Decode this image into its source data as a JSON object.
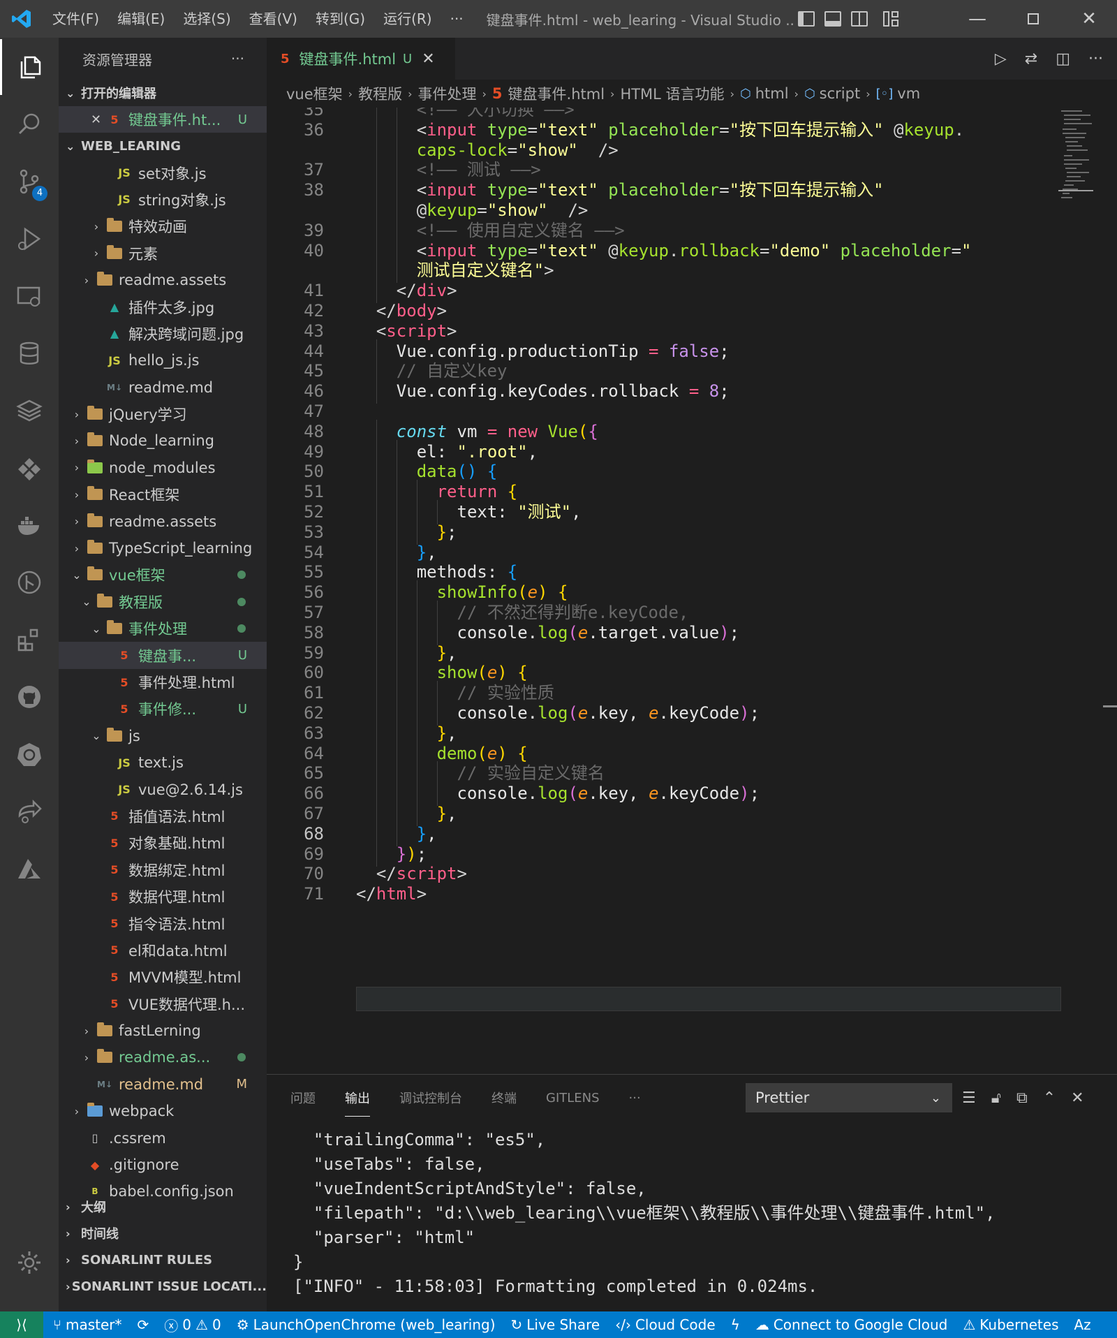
{
  "titlebar": {
    "menus": [
      "文件(F)",
      "编辑(E)",
      "选择(S)",
      "查看(V)",
      "转到(G)",
      "运行(R)",
      "···"
    ],
    "window_title": "键盘事件.html - web_learing - Visual Studio ..."
  },
  "activity": {
    "scm_badge": "4"
  },
  "sidebar": {
    "title": "资源管理器",
    "more": "···",
    "open_editors_label": "打开的编辑器",
    "open_editor": {
      "name": "键盘事件.ht...",
      "status": "U"
    },
    "workspace_label": "WEB_LEARING",
    "tree": [
      {
        "name": "set对象.js",
        "icon": "js",
        "depth": 4
      },
      {
        "name": "string对象.js",
        "icon": "js",
        "depth": 4
      },
      {
        "name": "特效动画",
        "icon": "folder",
        "depth": 3,
        "chevron": "›"
      },
      {
        "name": "元素",
        "icon": "folder",
        "depth": 3,
        "chevron": "›"
      },
      {
        "name": "readme.assets",
        "icon": "folder",
        "depth": 2,
        "chevron": "›"
      },
      {
        "name": "插件太多.jpg",
        "icon": "img",
        "depth": 3
      },
      {
        "name": "解决跨域问题.jpg",
        "icon": "img",
        "depth": 3
      },
      {
        "name": "hello_js.js",
        "icon": "js",
        "depth": 3
      },
      {
        "name": "readme.md",
        "icon": "md",
        "depth": 3
      },
      {
        "name": "jQuery学习",
        "icon": "folder",
        "depth": 1,
        "chevron": "›"
      },
      {
        "name": "Node_learning",
        "icon": "folder",
        "depth": 1,
        "chevron": "›"
      },
      {
        "name": "node_modules",
        "icon": "folder-node",
        "depth": 1,
        "chevron": "›"
      },
      {
        "name": "React框架",
        "icon": "folder",
        "depth": 1,
        "chevron": "›"
      },
      {
        "name": "readme.assets",
        "icon": "folder",
        "depth": 1,
        "chevron": "›"
      },
      {
        "name": "TypeScript_learning",
        "icon": "folder",
        "depth": 1,
        "chevron": "›"
      },
      {
        "name": "vue框架",
        "icon": "folder",
        "depth": 1,
        "chevron": "⌄",
        "color": "green",
        "dot": true
      },
      {
        "name": "教程版",
        "icon": "folder",
        "depth": 2,
        "chevron": "⌄",
        "color": "green",
        "dot": true
      },
      {
        "name": "事件处理",
        "icon": "folder",
        "depth": 3,
        "chevron": "⌄",
        "color": "green",
        "dot": true
      },
      {
        "name": "键盘事...",
        "icon": "html",
        "depth": 4,
        "color": "green",
        "status": "U",
        "selected": true
      },
      {
        "name": "事件处理.html",
        "icon": "html",
        "depth": 4
      },
      {
        "name": "事件修...",
        "icon": "html",
        "depth": 4,
        "color": "green",
        "status": "U"
      },
      {
        "name": "js",
        "icon": "folder",
        "depth": 3,
        "chevron": "⌄"
      },
      {
        "name": "text.js",
        "icon": "js",
        "depth": 4
      },
      {
        "name": "vue@2.6.14.js",
        "icon": "js",
        "depth": 4
      },
      {
        "name": "插值语法.html",
        "icon": "html",
        "depth": 3
      },
      {
        "name": "对象基础.html",
        "icon": "html",
        "depth": 3
      },
      {
        "name": "数据绑定.html",
        "icon": "html",
        "depth": 3
      },
      {
        "name": "数据代理.html",
        "icon": "html",
        "depth": 3
      },
      {
        "name": "指令语法.html",
        "icon": "html",
        "depth": 3
      },
      {
        "name": "el和data.html",
        "icon": "html",
        "depth": 3
      },
      {
        "name": "MVVM模型.html",
        "icon": "html",
        "depth": 3
      },
      {
        "name": "VUE数据代理.h...",
        "icon": "html",
        "depth": 3
      },
      {
        "name": "fastLerning",
        "icon": "folder",
        "depth": 2,
        "chevron": "›"
      },
      {
        "name": "readme.as...",
        "icon": "folder",
        "depth": 2,
        "chevron": "›",
        "color": "green",
        "dot": true
      },
      {
        "name": "readme.md",
        "icon": "md",
        "depth": 2,
        "color": "yellowish",
        "status": "M"
      },
      {
        "name": "webpack",
        "icon": "folder-wp",
        "depth": 1,
        "chevron": "›"
      },
      {
        "name": ".cssrem",
        "icon": "file",
        "depth": 1
      },
      {
        "name": ".gitignore",
        "icon": "git",
        "depth": 1
      },
      {
        "name": "babel.config.json",
        "icon": "babel",
        "depth": 1
      }
    ],
    "bottom_sections": [
      "大纲",
      "时间线",
      "SONARLINT RULES",
      "SONARLINT ISSUE LOCATI..."
    ]
  },
  "tab": {
    "name": "键盘事件.html",
    "status": "U"
  },
  "breadcrumb": [
    "vue框架",
    "教程版",
    "事件处理",
    "键盘事件.html",
    "HTML 语言功能",
    "html",
    "script",
    "vm"
  ],
  "code_lines": [
    {
      "n": "35",
      "i": 3,
      "t": [
        [
          "cm",
          "<!—— 大小切换 ——>"
        ]
      ]
    },
    {
      "n": "36",
      "i": 3,
      "t": [
        [
          "br",
          "<"
        ],
        [
          "tag",
          "input"
        ],
        [
          "id",
          " "
        ],
        [
          "attr",
          "type"
        ],
        [
          "br",
          "="
        ],
        [
          "str",
          "\"text\""
        ],
        [
          "id",
          " "
        ],
        [
          "attr",
          "placeholder"
        ],
        [
          "br",
          "="
        ],
        [
          "str",
          "\"按下回车提示输入\""
        ],
        [
          "id",
          " "
        ],
        [
          "br",
          "@"
        ],
        [
          "dir",
          "keyup"
        ],
        [
          "br",
          "."
        ]
      ]
    },
    {
      "n": "",
      "i": 3,
      "t": [
        [
          "dir",
          "caps-lock"
        ],
        [
          "br",
          "="
        ],
        [
          "str",
          "\"show\""
        ],
        [
          "id",
          "  "
        ],
        [
          "br",
          "/>"
        ]
      ]
    },
    {
      "n": "37",
      "i": 3,
      "t": [
        [
          "cm",
          "<!—— 测试 ——>"
        ]
      ]
    },
    {
      "n": "38",
      "i": 3,
      "t": [
        [
          "br",
          "<"
        ],
        [
          "tag",
          "input"
        ],
        [
          "id",
          " "
        ],
        [
          "attr",
          "type"
        ],
        [
          "br",
          "="
        ],
        [
          "str",
          "\"text\""
        ],
        [
          "id",
          " "
        ],
        [
          "attr",
          "placeholder"
        ],
        [
          "br",
          "="
        ],
        [
          "str",
          "\"按下回车提示输入\""
        ]
      ]
    },
    {
      "n": "",
      "i": 3,
      "t": [
        [
          "br",
          "@"
        ],
        [
          "dir",
          "keyup"
        ],
        [
          "br",
          "="
        ],
        [
          "str",
          "\"show\""
        ],
        [
          "id",
          "  "
        ],
        [
          "br",
          "/>"
        ]
      ]
    },
    {
      "n": "39",
      "i": 3,
      "t": [
        [
          "cm",
          "<!—— 使用自定义键名 ——>"
        ]
      ]
    },
    {
      "n": "40",
      "i": 3,
      "t": [
        [
          "br",
          "<"
        ],
        [
          "tag",
          "input"
        ],
        [
          "id",
          " "
        ],
        [
          "attr",
          "type"
        ],
        [
          "br",
          "="
        ],
        [
          "str",
          "\"text\""
        ],
        [
          "id",
          " "
        ],
        [
          "br",
          "@"
        ],
        [
          "dir",
          "keyup"
        ],
        [
          "br",
          "."
        ],
        [
          "dir",
          "rollback"
        ],
        [
          "br",
          "="
        ],
        [
          "str",
          "\"demo\""
        ],
        [
          "id",
          " "
        ],
        [
          "attr",
          "placeholder"
        ],
        [
          "br",
          "="
        ],
        [
          "str",
          "\""
        ]
      ]
    },
    {
      "n": "",
      "i": 3,
      "t": [
        [
          "str",
          "测试自定义键名\""
        ],
        [
          "br",
          ">"
        ]
      ]
    },
    {
      "n": "41",
      "i": 2,
      "t": [
        [
          "br",
          "</"
        ],
        [
          "tag",
          "div"
        ],
        [
          "br",
          ">"
        ]
      ]
    },
    {
      "n": "42",
      "i": 1,
      "t": [
        [
          "br",
          "</"
        ],
        [
          "tag",
          "body"
        ],
        [
          "br",
          ">"
        ]
      ]
    },
    {
      "n": "43",
      "i": 1,
      "t": [
        [
          "br",
          "<"
        ],
        [
          "tag",
          "script"
        ],
        [
          "br",
          ">"
        ]
      ]
    },
    {
      "n": "44",
      "i": 2,
      "t": [
        [
          "id",
          "Vue.config.productionTip "
        ],
        [
          "op",
          "="
        ],
        [
          "id",
          " "
        ],
        [
          "bool",
          "false"
        ],
        [
          "id",
          ";"
        ]
      ]
    },
    {
      "n": "45",
      "i": 2,
      "t": [
        [
          "cm",
          "// 自定义key"
        ]
      ]
    },
    {
      "n": "46",
      "i": 2,
      "t": [
        [
          "id",
          "Vue.config.keyCodes.rollback "
        ],
        [
          "op",
          "="
        ],
        [
          "id",
          " "
        ],
        [
          "num",
          "8"
        ],
        [
          "id",
          ";"
        ]
      ]
    },
    {
      "n": "47",
      "i": 0,
      "t": []
    },
    {
      "n": "48",
      "i": 2,
      "t": [
        [
          "const",
          "const"
        ],
        [
          "id",
          " vm "
        ],
        [
          "op",
          "="
        ],
        [
          "id",
          " "
        ],
        [
          "kw",
          "new"
        ],
        [
          "id",
          " "
        ],
        [
          "fn",
          "Vue"
        ],
        [
          "p1",
          "("
        ],
        [
          "p2",
          "{"
        ]
      ]
    },
    {
      "n": "49",
      "i": 3,
      "t": [
        [
          "id",
          "el: "
        ],
        [
          "str",
          "\".root\""
        ],
        [
          "id",
          ","
        ]
      ]
    },
    {
      "n": "50",
      "i": 3,
      "t": [
        [
          "fn",
          "data"
        ],
        [
          "p3",
          "()"
        ],
        [
          "id",
          " "
        ],
        [
          "p3",
          "{"
        ]
      ]
    },
    {
      "n": "51",
      "i": 4,
      "t": [
        [
          "kw",
          "return"
        ],
        [
          "id",
          " "
        ],
        [
          "p1",
          "{"
        ]
      ]
    },
    {
      "n": "52",
      "i": 5,
      "t": [
        [
          "id",
          "text: "
        ],
        [
          "str",
          "\"测试\""
        ],
        [
          "id",
          ","
        ]
      ]
    },
    {
      "n": "53",
      "i": 4,
      "t": [
        [
          "p1",
          "}"
        ],
        [
          "id",
          ";"
        ]
      ]
    },
    {
      "n": "54",
      "i": 3,
      "t": [
        [
          "p3",
          "}"
        ],
        [
          "id",
          ","
        ]
      ]
    },
    {
      "n": "55",
      "i": 3,
      "t": [
        [
          "id",
          "methods: "
        ],
        [
          "p3",
          "{"
        ]
      ]
    },
    {
      "n": "56",
      "i": 4,
      "t": [
        [
          "fn",
          "showInfo"
        ],
        [
          "p1",
          "("
        ],
        [
          "param",
          "e"
        ],
        [
          "p1",
          ")"
        ],
        [
          "id",
          " "
        ],
        [
          "p1",
          "{"
        ]
      ]
    },
    {
      "n": "57",
      "i": 5,
      "t": [
        [
          "cm",
          "// 不然还得判断e.keyCode,"
        ]
      ]
    },
    {
      "n": "58",
      "i": 5,
      "t": [
        [
          "id",
          "console."
        ],
        [
          "fn",
          "log"
        ],
        [
          "p2",
          "("
        ],
        [
          "param",
          "e"
        ],
        [
          "id",
          ".target.value"
        ],
        [
          "p2",
          ")"
        ],
        [
          "id",
          ";"
        ]
      ]
    },
    {
      "n": "59",
      "i": 4,
      "t": [
        [
          "p1",
          "}"
        ],
        [
          "id",
          ","
        ]
      ]
    },
    {
      "n": "60",
      "i": 4,
      "t": [
        [
          "fn",
          "show"
        ],
        [
          "p1",
          "("
        ],
        [
          "param",
          "e"
        ],
        [
          "p1",
          ")"
        ],
        [
          "id",
          " "
        ],
        [
          "p1",
          "{"
        ]
      ]
    },
    {
      "n": "61",
      "i": 5,
      "t": [
        [
          "cm",
          "// 实验性质"
        ]
      ]
    },
    {
      "n": "62",
      "i": 5,
      "t": [
        [
          "id",
          "console."
        ],
        [
          "fn",
          "log"
        ],
        [
          "p2",
          "("
        ],
        [
          "param",
          "e"
        ],
        [
          "id",
          ".key, "
        ],
        [
          "param",
          "e"
        ],
        [
          "id",
          ".keyCode"
        ],
        [
          "p2",
          ")"
        ],
        [
          "id",
          ";"
        ]
      ]
    },
    {
      "n": "63",
      "i": 4,
      "t": [
        [
          "p1",
          "}"
        ],
        [
          "id",
          ","
        ]
      ]
    },
    {
      "n": "64",
      "i": 4,
      "t": [
        [
          "fn",
          "demo"
        ],
        [
          "p1",
          "("
        ],
        [
          "param",
          "e"
        ],
        [
          "p1",
          ")"
        ],
        [
          "id",
          " "
        ],
        [
          "p1",
          "{"
        ]
      ]
    },
    {
      "n": "65",
      "i": 5,
      "t": [
        [
          "cm",
          "// 实验自定义键名"
        ]
      ]
    },
    {
      "n": "66",
      "i": 5,
      "t": [
        [
          "id",
          "console."
        ],
        [
          "fn",
          "log"
        ],
        [
          "p2",
          "("
        ],
        [
          "param",
          "e"
        ],
        [
          "id",
          ".key, "
        ],
        [
          "param",
          "e"
        ],
        [
          "id",
          ".keyCode"
        ],
        [
          "p2",
          ")"
        ],
        [
          "id",
          ";"
        ]
      ]
    },
    {
      "n": "67",
      "i": 4,
      "t": [
        [
          "p1",
          "}"
        ],
        [
          "id",
          ","
        ]
      ]
    },
    {
      "n": "68",
      "i": 3,
      "t": [
        [
          "p3",
          "}"
        ],
        [
          "id",
          ","
        ]
      ],
      "current": true
    },
    {
      "n": "69",
      "i": 2,
      "t": [
        [
          "p2",
          "}"
        ],
        [
          "p1",
          ")"
        ],
        [
          "id",
          ";"
        ]
      ]
    },
    {
      "n": "70",
      "i": 1,
      "t": [
        [
          "br",
          "</"
        ],
        [
          "tag",
          "script"
        ],
        [
          "br",
          ">"
        ]
      ]
    },
    {
      "n": "71",
      "i": 0,
      "t": [
        [
          "br",
          "</"
        ],
        [
          "tag",
          "html"
        ],
        [
          "br",
          ">"
        ]
      ]
    }
  ],
  "panel": {
    "tabs": [
      "问题",
      "输出",
      "调试控制台",
      "终端",
      "GITLENS",
      "···"
    ],
    "active_tab": "输出",
    "channel": "Prettier",
    "output": [
      "  \"trailingComma\": \"es5\",",
      "  \"useTabs\": false,",
      "  \"vueIndentScriptAndStyle\": false,",
      "  \"filepath\": \"d:\\\\web_learing\\\\vue框架\\\\教程版\\\\事件处理\\\\键盘事件.html\",",
      "  \"parser\": \"html\"",
      "}",
      "[\"INFO\" - 11:58:03] Formatting completed in 0.024ms."
    ]
  },
  "statusbar": {
    "branch": "master*",
    "errors": "0",
    "warnings": "0",
    "launch": "LaunchOpenChrome (web_learing)",
    "live_share": "Live Share",
    "cloud_code": "Cloud Code",
    "google_cloud": "Connect to Google Cloud",
    "kubernetes": "Kubernetes",
    "overflow": "Az"
  }
}
